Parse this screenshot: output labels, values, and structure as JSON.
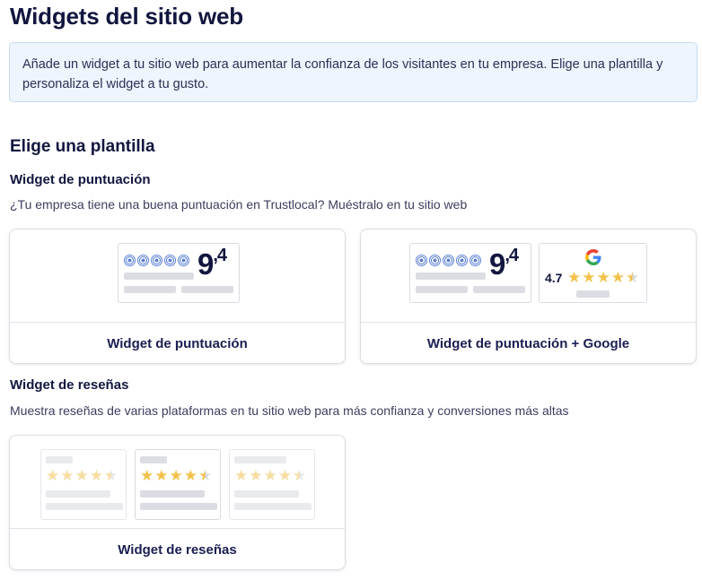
{
  "page": {
    "title": "Widgets del sitio web",
    "info": "Añade un widget a tu sitio web para aumentar la confianza de los visitantes en tu empresa. Elige una plantilla y personaliza el widget a tu gusto."
  },
  "template_section": {
    "title": "Elige una plantilla"
  },
  "rating_widgets": {
    "title": "Widget de puntuación",
    "description": "¿Tu empresa tiene una buena puntuación en Trustlocal? Muéstralo en tu sitio web",
    "cards": [
      {
        "label": "Widget de puntuación",
        "score_int": "9",
        "score_dec": ",4"
      },
      {
        "label": "Widget de puntuación + Google",
        "score_int": "9",
        "score_dec": ",4",
        "google_rating": "4.7"
      }
    ]
  },
  "review_widgets": {
    "title": "Widget de reseñas",
    "description": "Muestra reseñas de varias plataformas en tu sitio web para más confianza y conversiones más altas",
    "cards": [
      {
        "label": "Widget de reseñas"
      }
    ]
  },
  "colors": {
    "navy": "#12163f",
    "info_bg": "#eef5fd",
    "info_border": "#c7daf0",
    "star": "#f2c14a",
    "logo_blue": "#5a80d4"
  },
  "icons": [
    "trustlocal-logo-icon",
    "google-logo-icon",
    "star-icon"
  ]
}
